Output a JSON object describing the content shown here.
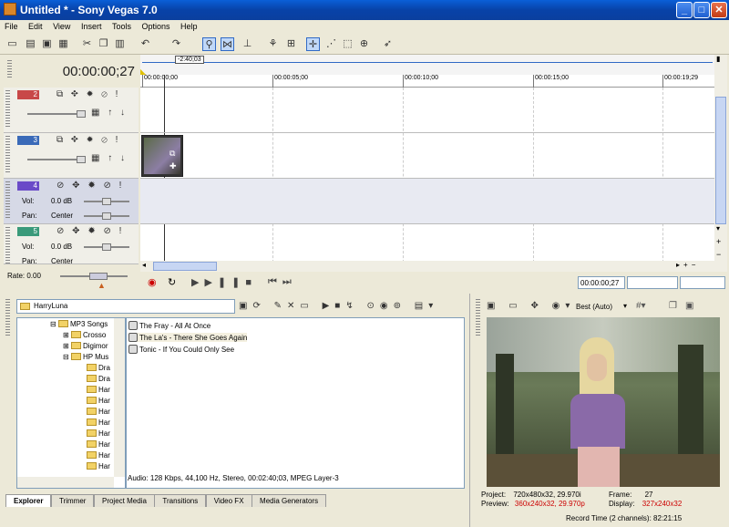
{
  "window": {
    "title": "Untitled * - Sony Vegas 7.0"
  },
  "menu": [
    "File",
    "Edit",
    "View",
    "Insert",
    "Tools",
    "Options",
    "Help"
  ],
  "timecode": "00:00:00;27",
  "selection_marker": "-2:40;03",
  "ruler": [
    "00:00:00;00",
    "00:00:05;00",
    "00:00:10;00",
    "00:00:15;00",
    "00:00:19;29"
  ],
  "tracks": [
    {
      "num": "2",
      "color": "#c84848",
      "type": "video"
    },
    {
      "num": "3",
      "color": "#3a6ab8",
      "type": "video"
    },
    {
      "num": "4",
      "color": "#6a4ac8",
      "type": "audio",
      "vol": "0.0 dB",
      "pan": "Center"
    },
    {
      "num": "5",
      "color": "#3a9a7a",
      "type": "audio",
      "vol": "0.0 dB",
      "pan": "Center"
    }
  ],
  "labels": {
    "vol": "Vol:",
    "pan": "Pan:",
    "rate": "Rate: 0.00"
  },
  "transport_time": "00:00:00;27",
  "explorer": {
    "path": "HarryLuna",
    "tree": [
      "MP3 Songs",
      "Crosso",
      "Digimor",
      "HP Mus",
      "Dra",
      "Dra",
      "Har",
      "Har",
      "Har",
      "Har",
      "Har",
      "Har",
      "Har",
      "Har"
    ],
    "files": [
      "The Fray - All At Once",
      "The La's - There She Goes Again",
      "Tonic - If You Could Only See"
    ],
    "file_info": "Audio: 128 Kbps, 44,100 Hz, Stereo, 00:02:40;03, MPEG Layer-3"
  },
  "tabs": [
    "Explorer",
    "Trimmer",
    "Project Media",
    "Transitions",
    "Video FX",
    "Media Generators"
  ],
  "preview": {
    "quality": "Best (Auto)",
    "project_label": "Project:",
    "project": "720x480x32, 29.970i",
    "preview_label": "Preview:",
    "preview": "360x240x32, 29.970p",
    "frame_label": "Frame:",
    "frame": "27",
    "display_label": "Display:",
    "display": "327x240x32"
  },
  "status": "Record Time (2 channels): 82:21:15"
}
